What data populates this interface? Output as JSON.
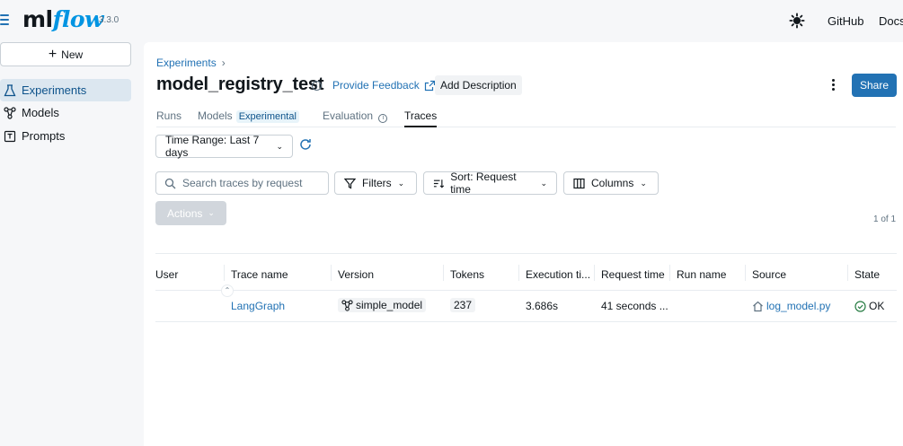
{
  "header": {
    "logo_ml": "ml",
    "logo_flow": "flow",
    "version": "3.3.0",
    "links": [
      "GitHub",
      "Docs"
    ]
  },
  "sidebar": {
    "new_label": "New",
    "items": [
      {
        "label": "Experiments",
        "icon": "beaker-icon",
        "active": true
      },
      {
        "label": "Models",
        "icon": "models-icon",
        "active": false
      },
      {
        "label": "Prompts",
        "icon": "prompt-icon",
        "active": false
      }
    ]
  },
  "page": {
    "breadcrumb": "Experiments",
    "breadcrumb_sep": "›",
    "title": "model_registry_test",
    "feedback_label": "Provide Feedback",
    "add_description_label": "Add Description",
    "share_label": "Share"
  },
  "tabs": [
    {
      "label": "Runs"
    },
    {
      "label": "Models",
      "tag": "Experimental"
    },
    {
      "label": "Evaluation"
    },
    {
      "label": "Traces",
      "active": true
    }
  ],
  "controls": {
    "time_range": "Time Range: Last 7 days",
    "search_placeholder": "Search traces by request",
    "filters": "Filters",
    "sort": "Sort: Request time",
    "columns": "Columns",
    "actions": "Actions",
    "pagination": "1 of 1"
  },
  "table": {
    "columns": [
      "User",
      "Trace name",
      "Version",
      "Tokens",
      "Execution ti...",
      "Request time",
      "Run name",
      "Source",
      "State"
    ],
    "rows": [
      {
        "user": "",
        "trace_name": "LangGraph",
        "version": "simple_model",
        "tokens": "237",
        "execution_time": "3.686s",
        "request_time": "41 seconds ...",
        "run_name": "",
        "source": "log_model.py",
        "state": "OK"
      }
    ]
  },
  "colors": {
    "accent": "#2272b4",
    "logo_blue": "#0194e2",
    "ok_green": "#277c43"
  }
}
